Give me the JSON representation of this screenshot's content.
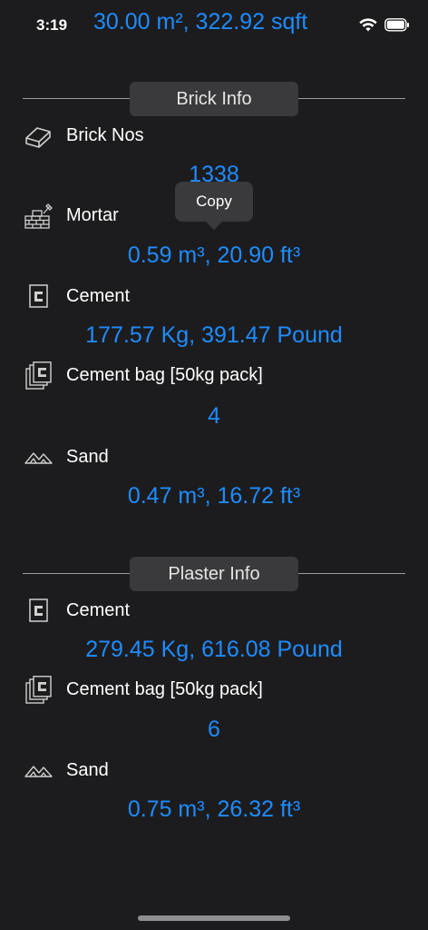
{
  "status_bar": {
    "time": "3:19",
    "area": "30.00 m², 322.92 sqft",
    "icons": [
      "wifi-icon",
      "battery-icon"
    ]
  },
  "brick_section": {
    "title": "Brick Info",
    "rows": [
      {
        "label": "Brick Nos",
        "value": "1338",
        "icon": "brick-icon"
      },
      {
        "label": "Mortar",
        "value": "0.59 m³, 20.90 ft³",
        "icon": "mortar-wall-icon"
      },
      {
        "label": "Cement",
        "value": "177.57 Kg, 391.47 Pound",
        "icon": "cement-icon"
      },
      {
        "label": "Cement bag [50kg pack]",
        "value": "4",
        "icon": "cement-bag-icon"
      },
      {
        "label": "Sand",
        "value": "0.47 m³, 16.72 ft³",
        "icon": "sand-icon"
      }
    ]
  },
  "plaster_section": {
    "title": "Plaster Info",
    "rows": [
      {
        "label": "Cement",
        "value": "279.45 Kg, 616.08 Pound",
        "icon": "cement-icon"
      },
      {
        "label": "Cement bag [50kg pack]",
        "value": "6",
        "icon": "cement-bag-icon"
      },
      {
        "label": "Sand",
        "value": "0.75 m³, 26.32 ft³",
        "icon": "sand-icon"
      }
    ]
  },
  "tooltip": {
    "label": "Copy"
  },
  "colors": {
    "background": "#1c1c1e",
    "accent": "#1e8cff",
    "pill": "#3a3a3c",
    "divider": "#9a9a9a"
  }
}
